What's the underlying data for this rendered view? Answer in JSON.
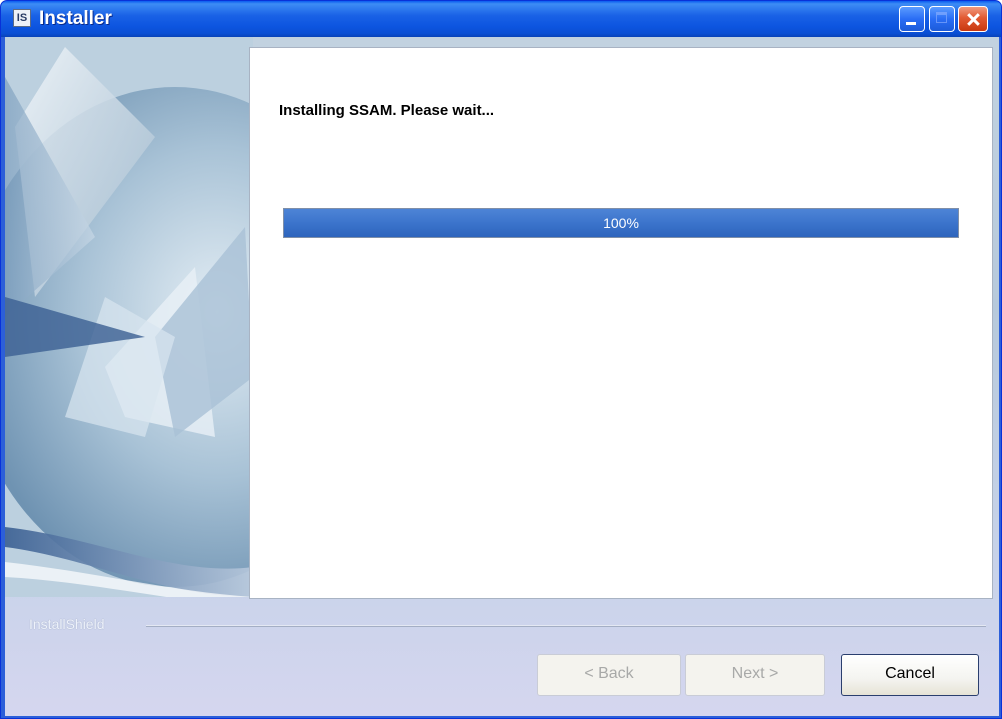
{
  "window": {
    "title": "Installer",
    "icon_text": "IS"
  },
  "main": {
    "status": "Installing SSAM. Please wait...",
    "progress": {
      "percent": 100,
      "label": "100%"
    }
  },
  "footer": {
    "brand": "InstallShield"
  },
  "buttons": {
    "back": "< Back",
    "next": "Next >",
    "cancel": "Cancel"
  },
  "colors": {
    "titlebar": "#0a55e0",
    "progress_fill": "#3c74cc",
    "close_button": "#e25a33"
  },
  "icons": {
    "app": "installshield-icon",
    "minimize": "minimize-icon",
    "maximize": "maximize-icon",
    "close": "close-icon"
  }
}
